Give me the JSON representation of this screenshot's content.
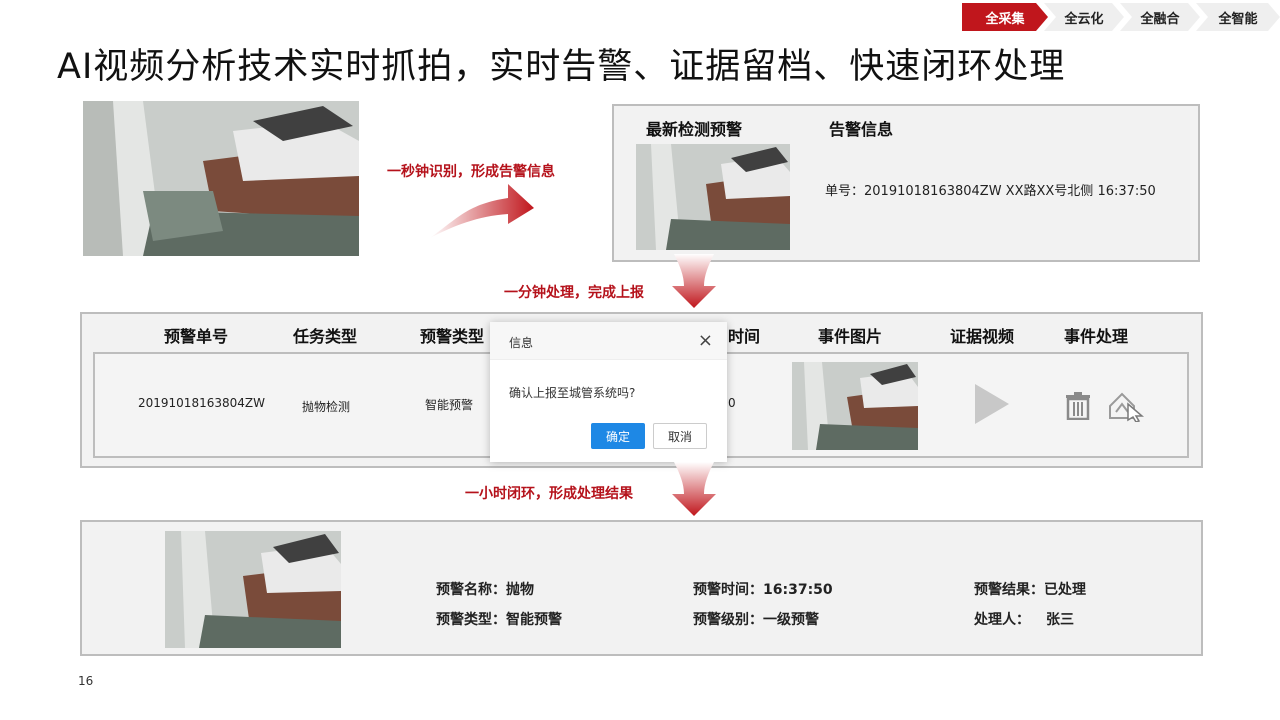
{
  "crumbs": [
    {
      "label": "全采集",
      "active": true
    },
    {
      "label": "全云化",
      "active": false
    },
    {
      "label": "全融合",
      "active": false
    },
    {
      "label": "全智能",
      "active": false
    }
  ],
  "title": "AI视频分析技术实时抓拍，实时告警、证据留档、快速闭环处理",
  "step1_label": "一秒钟识别，形成告警信息",
  "step2_label": "一分钟处理，完成上报",
  "step3_label": "一小时闭环，形成处理结果",
  "alert_panel": {
    "latest_heading": "最新检测预警",
    "info_heading": "告警信息",
    "info_text": "单号：20191018163804ZW    XX路XX号北侧    16:37:50"
  },
  "table": {
    "headers": [
      "预警单号",
      "任务类型",
      "预警类型",
      "时间",
      "事件图片",
      "证据视频",
      "事件处理"
    ],
    "row": {
      "order_no": "20191018163804ZW",
      "task_type": "抛物检测",
      "alert_type": "智能预警",
      "time_fragment": "0"
    }
  },
  "dialog": {
    "title": "信息",
    "close": "×",
    "message": "确认上报至城管系统吗?",
    "ok": "确定",
    "cancel": "取消"
  },
  "result": {
    "name": "预警名称：抛物",
    "type": "预警类型：智能预警",
    "time": "预警时间：16:37:50",
    "level": "预警级别：一级预警",
    "outcome": "预警结果：已处理",
    "handler_label": "处理人：",
    "handler_name": "张三"
  },
  "page_number": "16",
  "colors": {
    "accent": "#c0161c",
    "step_text": "#b5121b",
    "ok_button": "#1e88e5"
  }
}
